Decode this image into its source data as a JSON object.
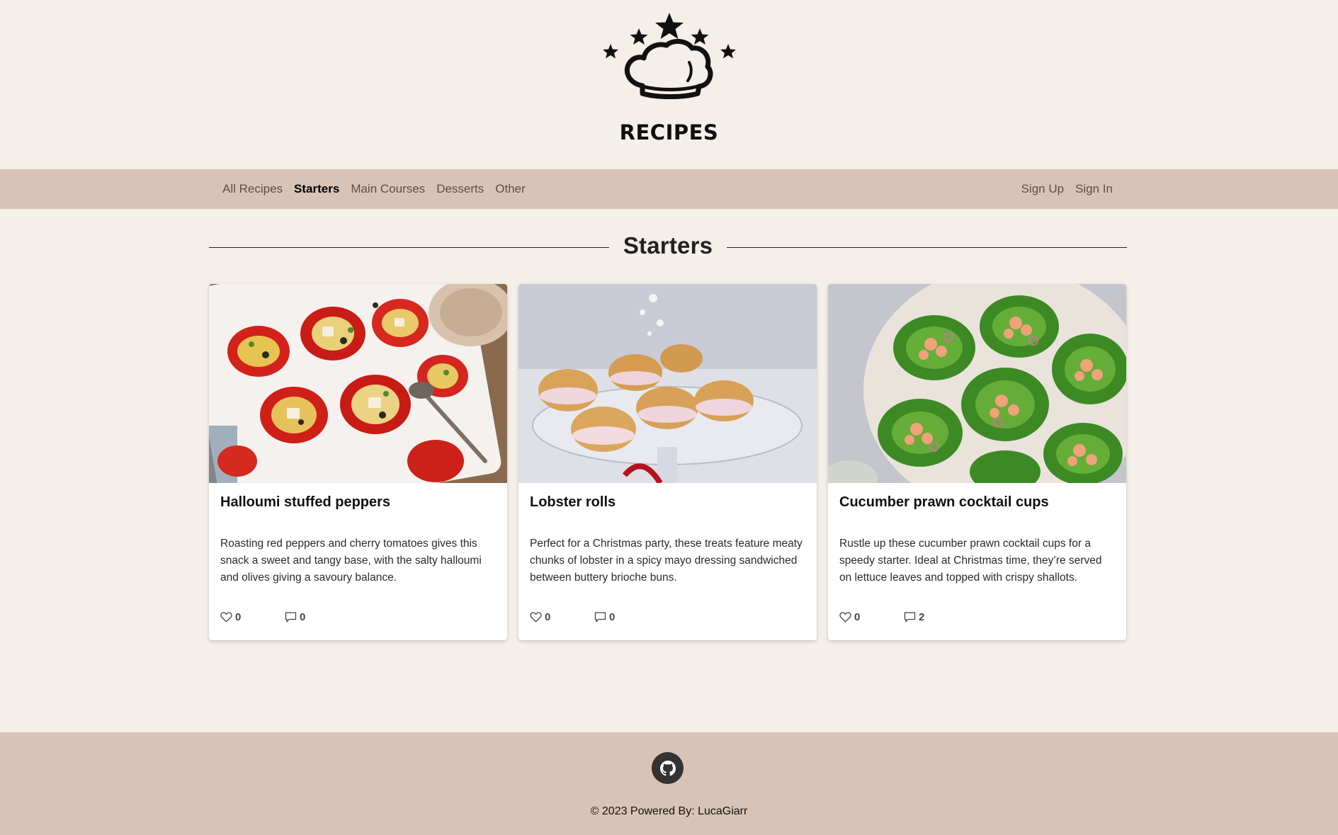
{
  "brand": {
    "logo_text": "RECIPES",
    "logo_icon": "chef-hat-with-stars"
  },
  "nav": {
    "left": [
      {
        "label": "All Recipes",
        "active": false
      },
      {
        "label": "Starters",
        "active": true
      },
      {
        "label": "Main Courses",
        "active": false
      },
      {
        "label": "Desserts",
        "active": false
      },
      {
        "label": "Other",
        "active": false
      }
    ],
    "right": [
      {
        "label": "Sign Up"
      },
      {
        "label": "Sign In"
      }
    ]
  },
  "page": {
    "title": "Starters"
  },
  "recipes": [
    {
      "title": "Halloumi stuffed peppers",
      "description": "Roasting red peppers and cherry tomatoes gives this snack a sweet and tangy base, with the salty halloumi and olives giving a savoury balance.",
      "likes": "0",
      "comments": "0",
      "image": "halloumi-stuffed-peppers-photo"
    },
    {
      "title": "Lobster rolls",
      "description": "Perfect for a Christmas party, these treats feature meaty chunks of lobster in a spicy mayo dressing sandwiched between buttery brioche buns.",
      "likes": "0",
      "comments": "0",
      "image": "lobster-rolls-photo"
    },
    {
      "title": "Cucumber prawn cocktail cups",
      "description": "Rustle up these cucumber prawn cocktail cups for a speedy starter. Ideal at Christmas time, they’re served on lettuce leaves and topped with crispy shallots.",
      "likes": "0",
      "comments": "2",
      "image": "cucumber-prawn-cocktail-cups-photo"
    }
  ],
  "footer": {
    "copyright": "© 2023 Powered By: LucaGiarr",
    "github_icon": "github-icon"
  },
  "colors": {
    "background": "#f5efe9",
    "navbar": "#d8c4b6",
    "card": "#ffffff",
    "github_button": "#333333"
  }
}
